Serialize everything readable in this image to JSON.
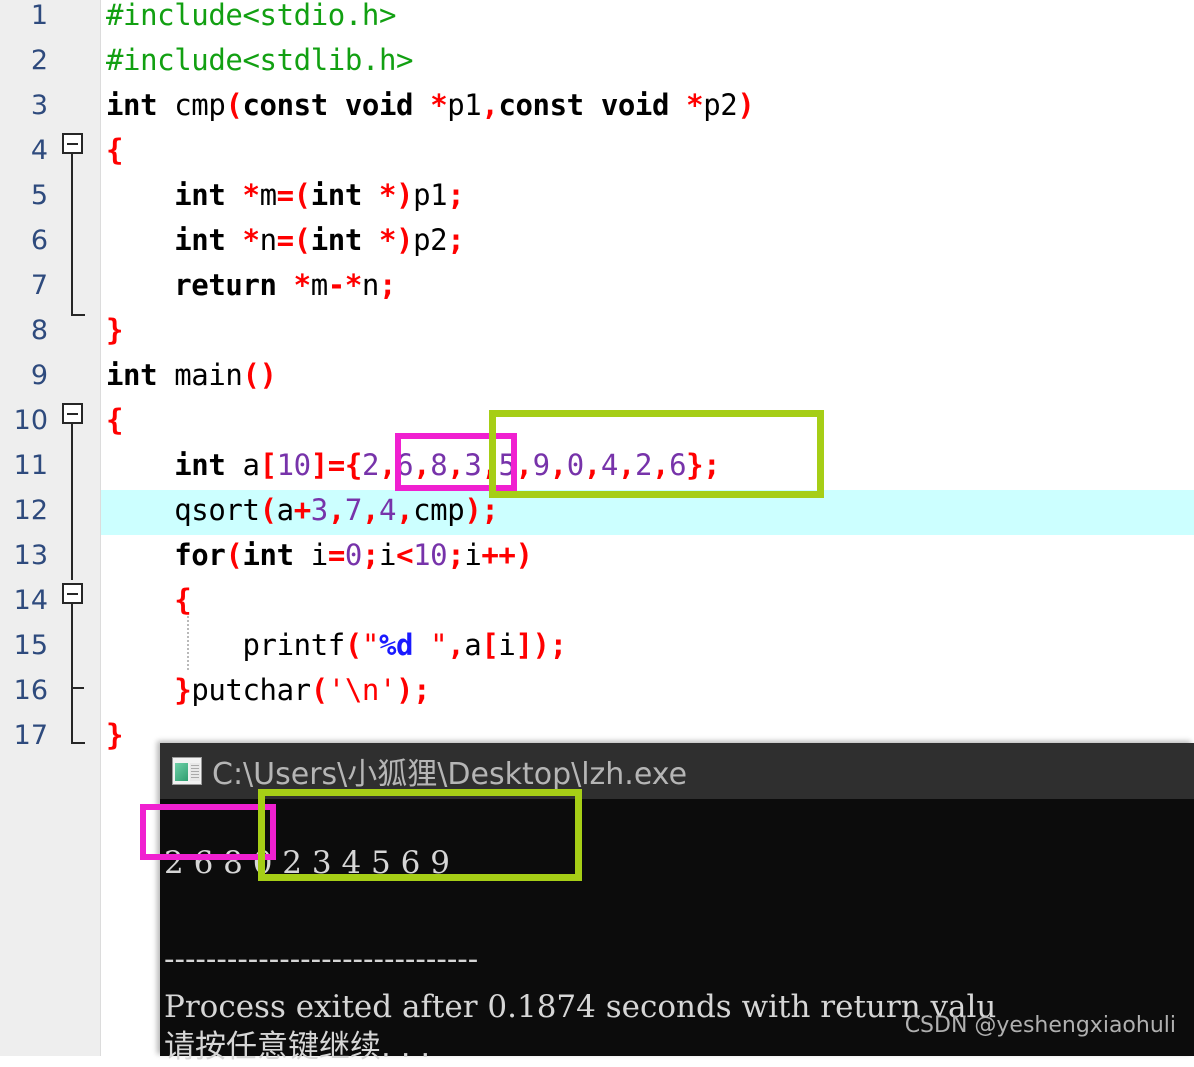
{
  "editor": {
    "gutter_bg": "#eeeeee",
    "line_number_color": "#2e4a7d",
    "highlight_color": "#ccffff",
    "line_numbers": [
      "1",
      "2",
      "3",
      "4",
      "5",
      "6",
      "7",
      "8",
      "9",
      "10",
      "11",
      "12",
      "13",
      "14",
      "15",
      "16",
      "17"
    ],
    "highlighted_line": "12",
    "lines": [
      {
        "n": "1",
        "text": "#include<stdio.h>"
      },
      {
        "n": "2",
        "text": "#include<stdlib.h>"
      },
      {
        "n": "3",
        "text": "int cmp(const void *p1,const void *p2)"
      },
      {
        "n": "4",
        "text": "{"
      },
      {
        "n": "5",
        "text": "    int *m=(int *)p1;"
      },
      {
        "n": "6",
        "text": "    int *n=(int *)p2;"
      },
      {
        "n": "7",
        "text": "    return *m-*n;"
      },
      {
        "n": "8",
        "text": "}"
      },
      {
        "n": "9",
        "text": "int main()"
      },
      {
        "n": "10",
        "text": "{"
      },
      {
        "n": "11",
        "text": "    int a[10]={2,6,8,3,5,9,0,4,2,6};"
      },
      {
        "n": "12",
        "text": "    qsort(a+3,7,4,cmp);"
      },
      {
        "n": "13",
        "text": "    for(int i=0;i<10;i++)"
      },
      {
        "n": "14",
        "text": "    {"
      },
      {
        "n": "15",
        "text": "        printf(\"%d \",a[i]);"
      },
      {
        "n": "16",
        "text": "    }putchar('\\n');"
      },
      {
        "n": "17",
        "text": "}"
      }
    ],
    "fold_markers": [
      "4",
      "10",
      "14"
    ]
  },
  "console": {
    "title": "C:\\Users\\小狐狸\\Desktop\\lzh.exe",
    "icon": "console-app-icon",
    "titlebar_bg": "#2f2f2f",
    "body_bg": "#0c0c0c",
    "output_line": "2 6 8 0 2 3 4 5 6 9",
    "separator": "------------------------------",
    "exit_line": "Process exited after 0.1874 seconds with return valu",
    "press_any_key": "请按任意键继续. . .",
    "watermark": "CSDN @yeshengxiaohuli"
  },
  "annotations": {
    "magenta_color": "#f020d0",
    "green_color": "#a6ce16",
    "code_magenta_label": "unsorted-prefix-code-box",
    "code_green_label": "qsort-range-code-box",
    "console_magenta_label": "unsorted-prefix-output-box",
    "console_green_label": "sorted-range-output-box"
  }
}
